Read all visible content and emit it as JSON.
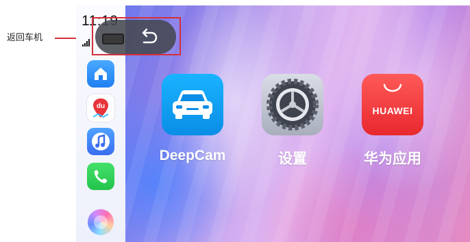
{
  "annotation": {
    "label": "返回车机",
    "color": "#d3303a"
  },
  "status_bar": {
    "time": "11:19"
  },
  "dock": [
    {
      "name": "home-icon"
    },
    {
      "name": "maps-icon",
      "badge": "du"
    },
    {
      "name": "music-icon"
    },
    {
      "name": "phone-icon"
    },
    {
      "name": "siri-icon"
    }
  ],
  "back_button": {
    "icon": "back-arrow-icon"
  },
  "apps": [
    {
      "label": "DeepCam",
      "icon": "car-icon",
      "color": "#0a8de6"
    },
    {
      "label": "设置",
      "icon": "gear-icon",
      "color": "#a8aebc"
    },
    {
      "label": "华为应用",
      "icon": "huawei-appgallery-icon",
      "brand": "HUAWEI",
      "color": "#e8282e"
    }
  ]
}
